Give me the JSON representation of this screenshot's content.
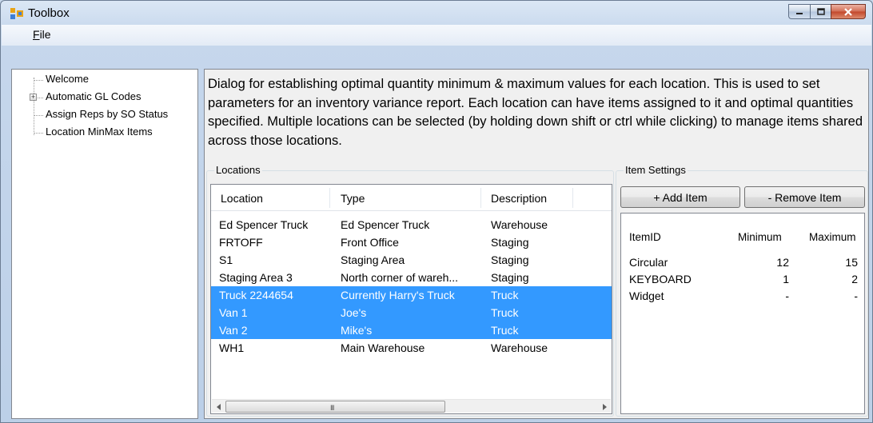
{
  "window": {
    "title": "Toolbox",
    "accent": "#3399ff"
  },
  "menu": {
    "file_prefix": "F",
    "file_rest": "ile"
  },
  "tree": {
    "items": [
      {
        "label": "Welcome",
        "expandable": false
      },
      {
        "label": "Automatic GL Codes",
        "expandable": true,
        "expander": "+"
      },
      {
        "label": "Assign Reps by SO Status",
        "expandable": false
      },
      {
        "label": "Location MinMax Items",
        "expandable": false
      }
    ]
  },
  "description": "Dialog for establishing optimal quantity minimum & maximum values for each location. This is used to set parameters for an inventory variance report. Each location can have items assigned to it and optimal quantities specified. Multiple locations can be selected (by holding down shift or ctrl while clicking) to manage items shared across those locations.",
  "locations": {
    "title": "Locations",
    "columns": [
      "Location",
      "Type",
      "Description"
    ],
    "rows": [
      {
        "location": "Ed Spencer Truck",
        "type": "Ed Spencer Truck",
        "description": "Warehouse",
        "selected": false
      },
      {
        "location": "FRTOFF",
        "type": "Front Office",
        "description": "Staging",
        "selected": false
      },
      {
        "location": "S1",
        "type": "Staging Area",
        "description": "Staging",
        "selected": false
      },
      {
        "location": "Staging Area 3",
        "type": "North corner of wareh...",
        "description": "Staging",
        "selected": false
      },
      {
        "location": "Truck 2244654",
        "type": "Currently Harry's Truck",
        "description": "Truck",
        "selected": true
      },
      {
        "location": "Van 1",
        "type": "Joe's",
        "description": "Truck",
        "selected": true
      },
      {
        "location": "Van 2",
        "type": "Mike's",
        "description": "Truck",
        "selected": true
      },
      {
        "location": "WH1",
        "type": "Main Warehouse",
        "description": "Warehouse",
        "selected": false
      }
    ],
    "scroll_grip": "III"
  },
  "item_settings": {
    "title": "Item Settings",
    "add_label": "+ Add Item",
    "remove_label": "- Remove Item",
    "columns": [
      "ItemID",
      "Minimum",
      "Maximum"
    ],
    "rows": [
      {
        "item": "Circular",
        "min": "12",
        "max": "15"
      },
      {
        "item": "KEYBOARD",
        "min": "1",
        "max": "2"
      },
      {
        "item": "Widget",
        "min": "-",
        "max": "-"
      }
    ]
  }
}
